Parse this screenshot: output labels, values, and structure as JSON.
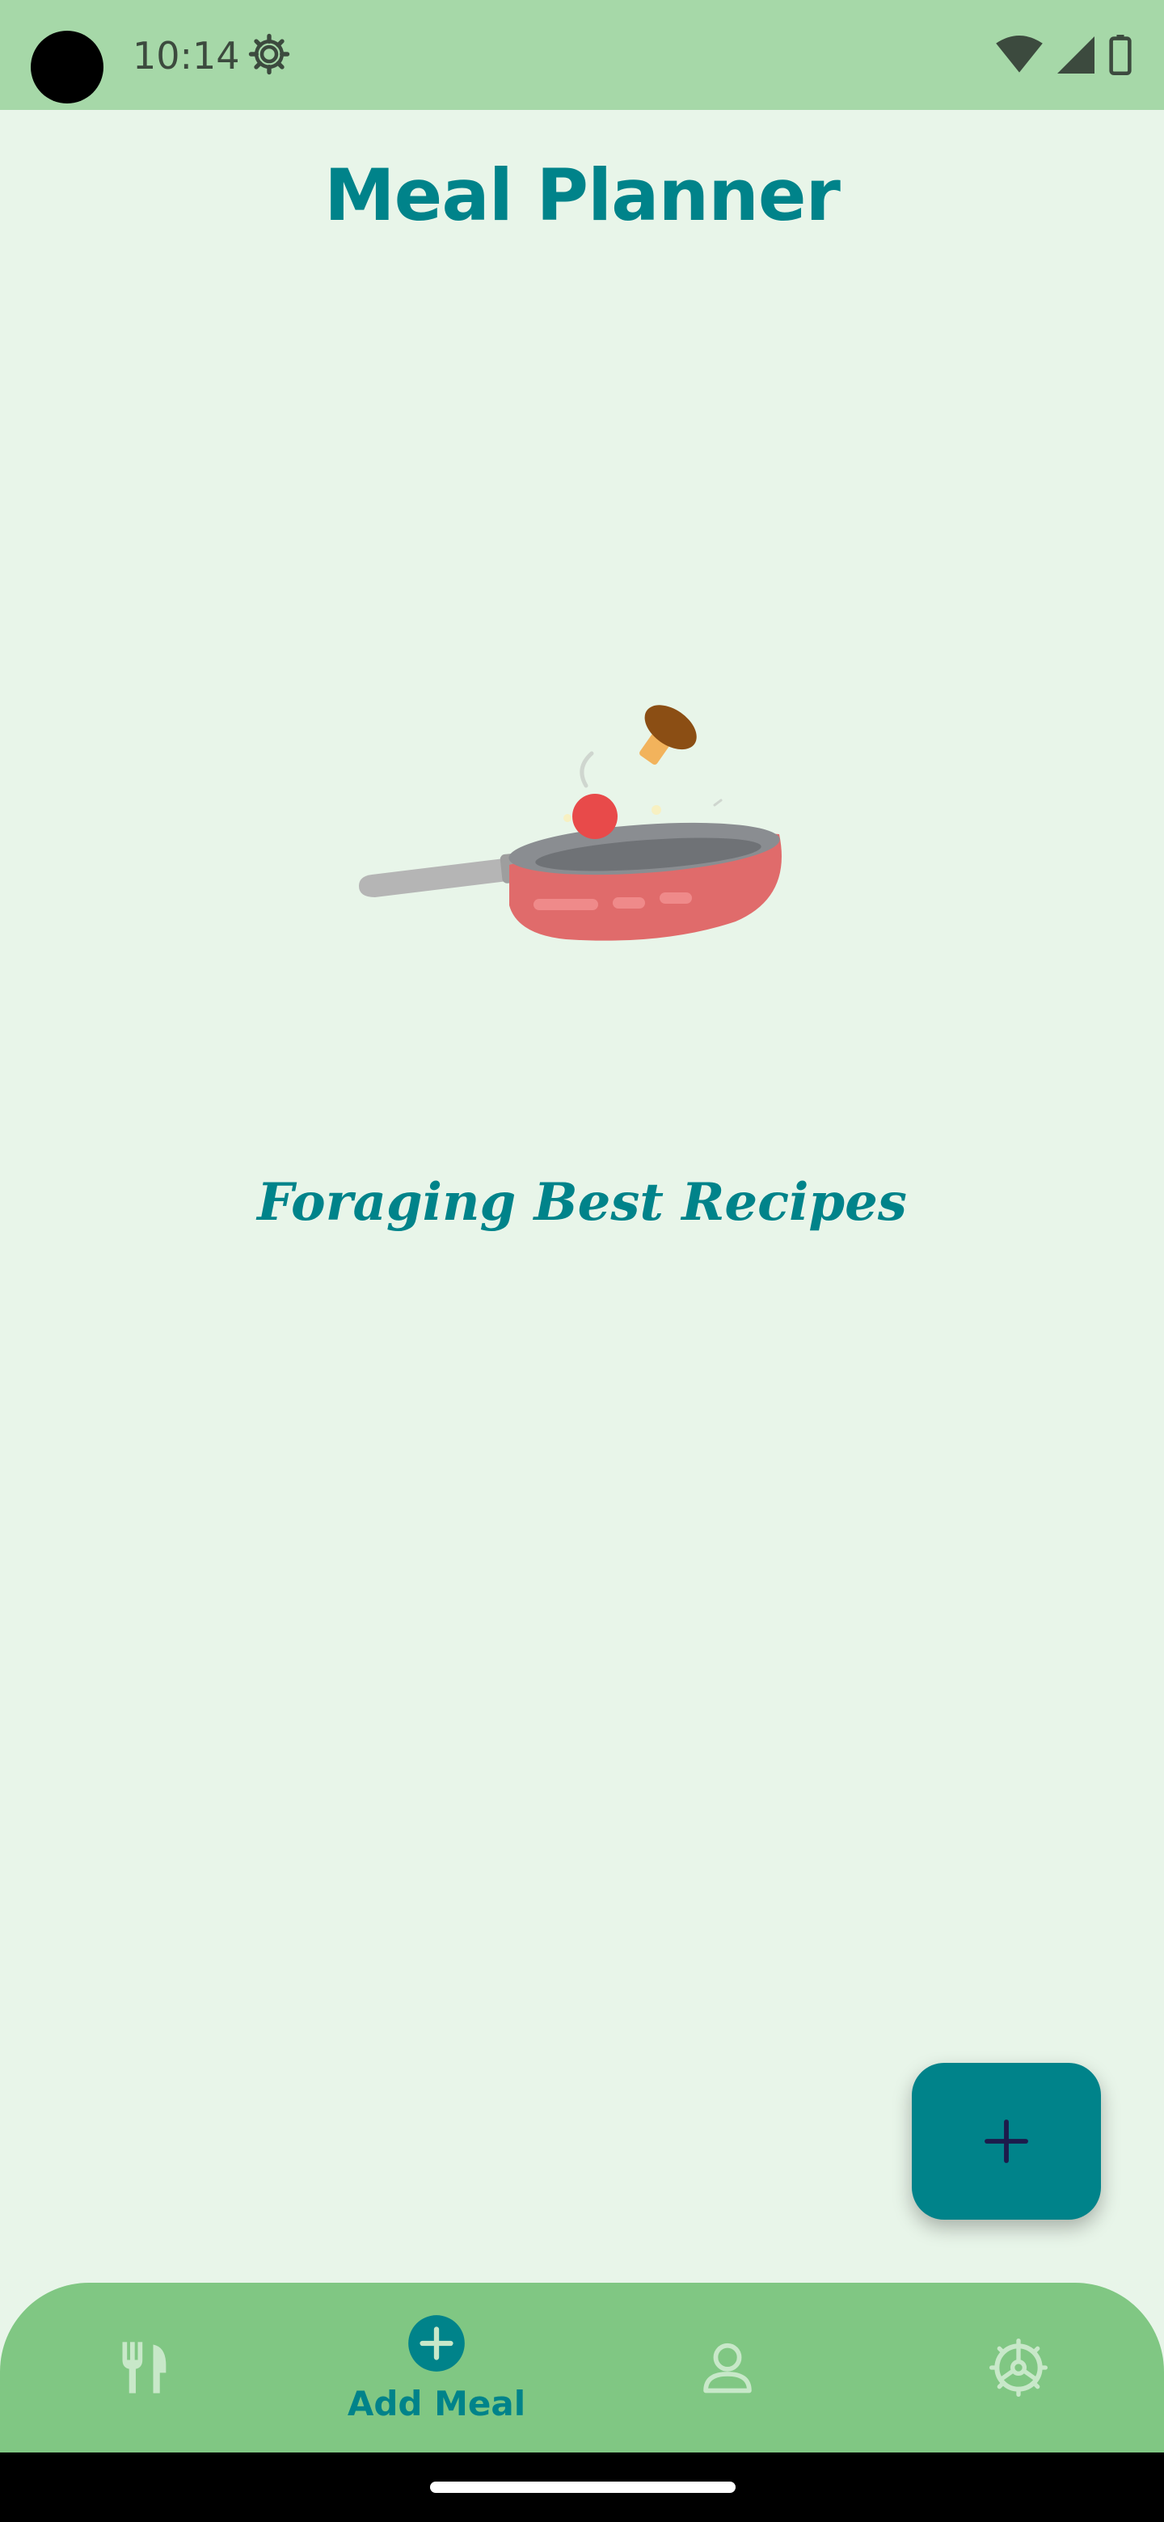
{
  "status_bar": {
    "time": "10:14",
    "icons": [
      "settings-icon",
      "wifi-icon",
      "signal-icon",
      "battery-icon"
    ]
  },
  "header": {
    "title": "Meal Planner"
  },
  "main": {
    "illustration": "frying-pan-illustration",
    "tagline": "Foraging Best Recipes"
  },
  "fab": {
    "icon": "plus-icon"
  },
  "bottom_nav": {
    "items": [
      {
        "icon": "utensils-icon",
        "label": "",
        "active": false
      },
      {
        "icon": "add-circle-icon",
        "label": "Add Meal",
        "active": true
      },
      {
        "icon": "profile-icon",
        "label": "",
        "active": false
      },
      {
        "icon": "settings-icon",
        "label": "",
        "active": false
      }
    ]
  },
  "colors": {
    "accent": "#00838a",
    "status_bar": "#a6d8a8",
    "background": "#e8f5e9",
    "nav_background": "#80c783"
  }
}
